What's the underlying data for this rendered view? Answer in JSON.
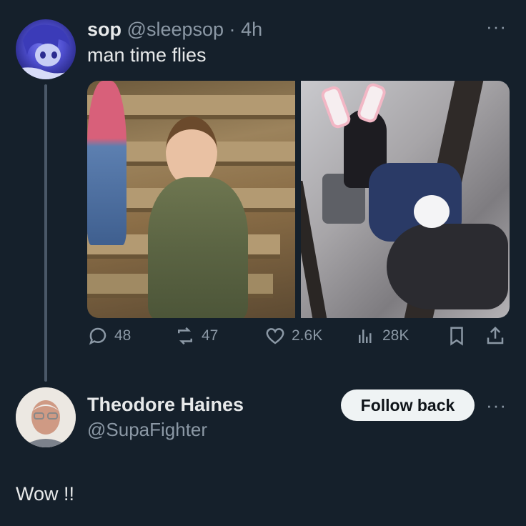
{
  "tweet": {
    "display_name": "sop",
    "handle": "@sleepsop",
    "separator": "·",
    "time": "4h",
    "text": "man time flies",
    "more_icon": "more-icon",
    "stats": {
      "replies": "48",
      "reposts": "47",
      "likes": "2.6K",
      "views": "28K"
    }
  },
  "reply_user": {
    "display_name": "Theodore Haines",
    "handle": "@SupaFighter",
    "follow_label": "Follow back"
  },
  "reply_text": "Wow !!",
  "colors": {
    "background": "#15202b",
    "text": "#e7e9ea",
    "muted": "#8b98a5",
    "button_bg": "#eff3f4"
  }
}
